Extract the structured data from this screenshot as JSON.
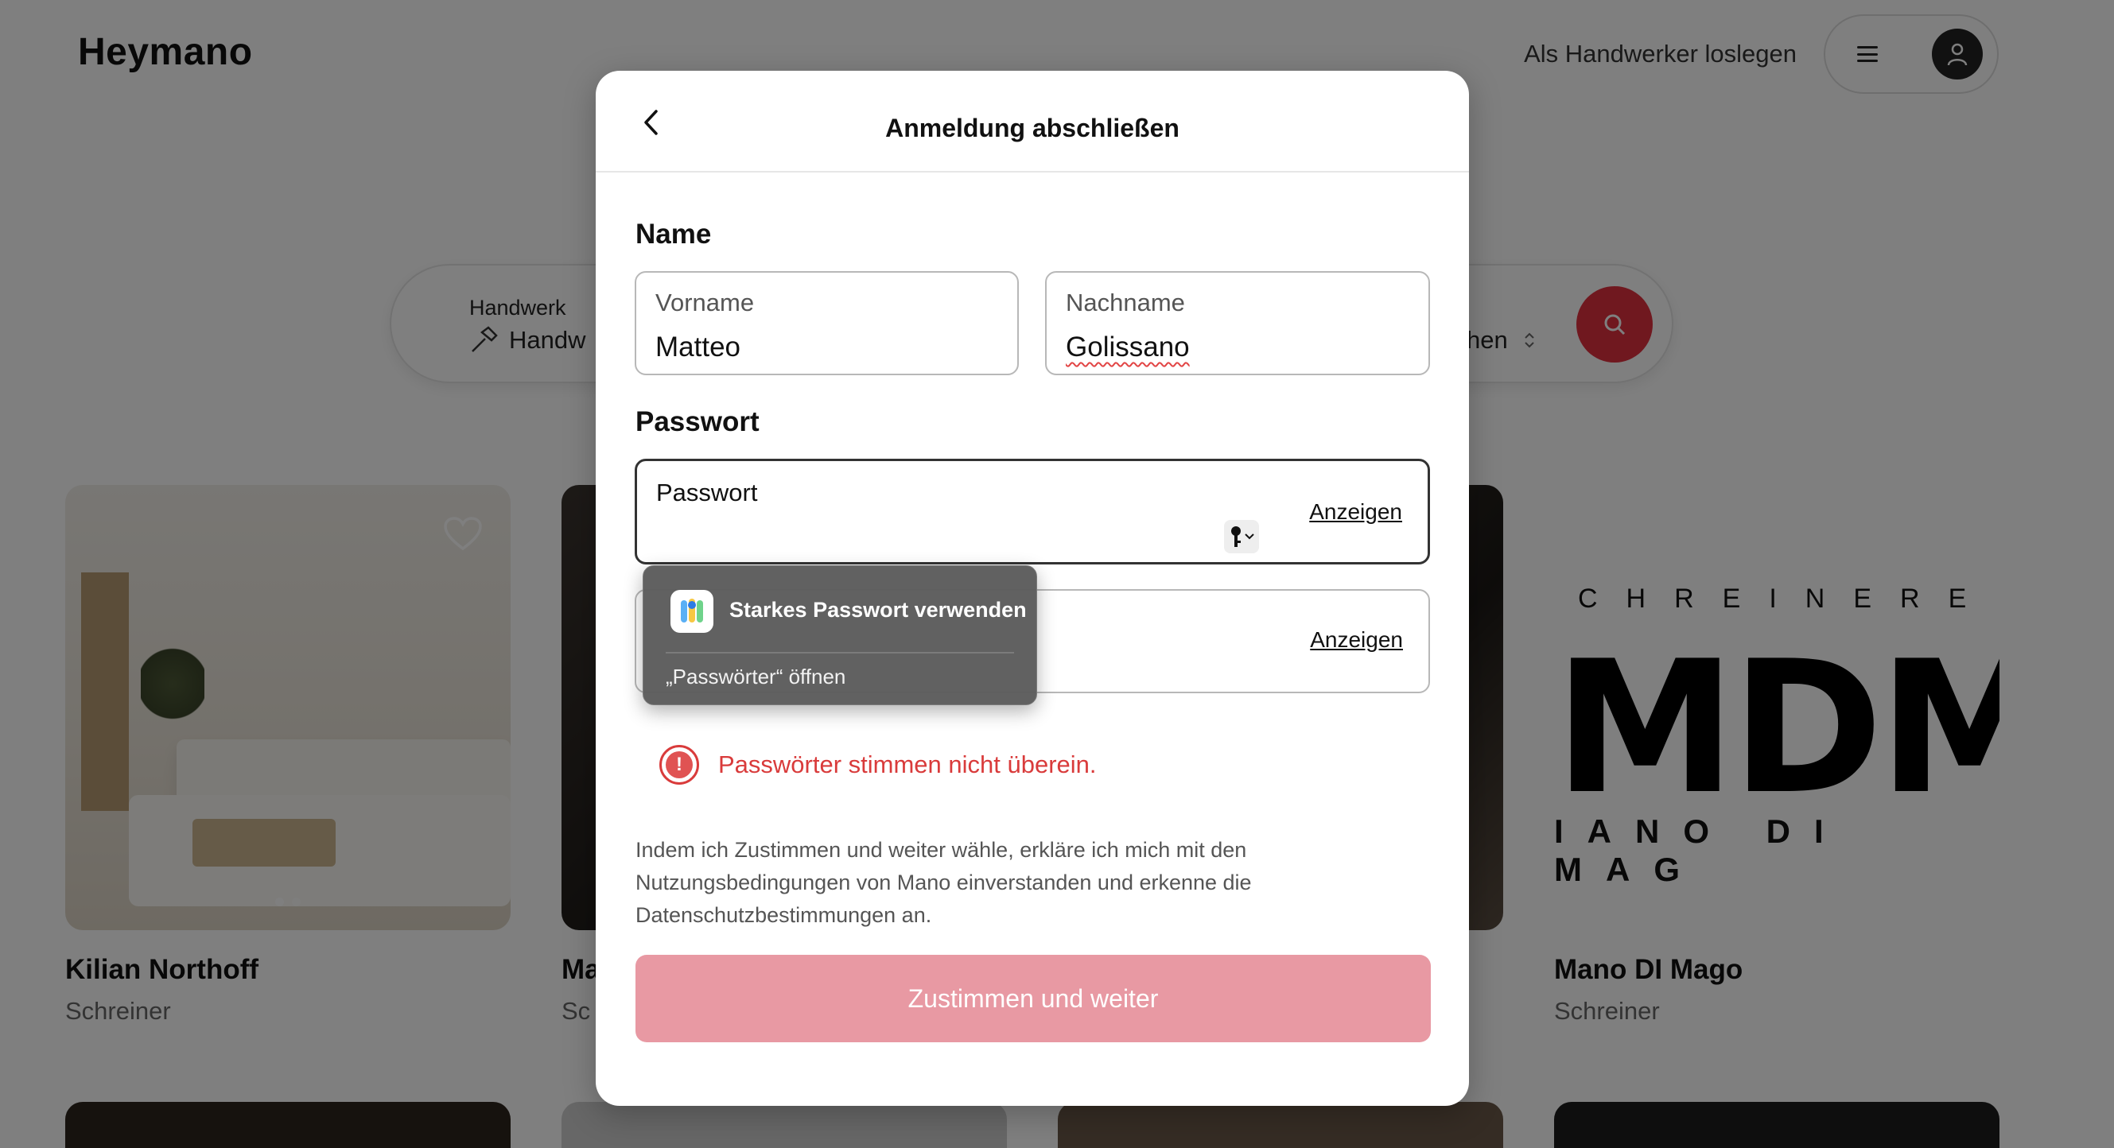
{
  "header": {
    "logo": "Heymano",
    "become_craftsman": "Als Handwerker loslegen"
  },
  "search": {
    "field1_label": "Handwerk",
    "field1_value": "Handw",
    "field2_value": "hen"
  },
  "cards": [
    {
      "name": "Kilian Northoff",
      "trade": "Schreiner"
    },
    {
      "name": "Ma",
      "trade": "Sc"
    },
    {
      "name": "Mano DI Mago",
      "trade": "Schreiner"
    }
  ],
  "mdm_logo": {
    "top": "CHREINERE",
    "main": "MDM",
    "bottom": "IANO DI MAG"
  },
  "modal": {
    "title": "Anmeldung abschließen",
    "name_section": "Name",
    "first_name_label": "Vorname",
    "first_name_value": "Matteo",
    "last_name_label": "Nachname",
    "last_name_value": "Golissano",
    "password_section": "Passwort",
    "password_placeholder": "Passwort",
    "show_label": "Anzeigen",
    "show_label_2": "Anzeigen",
    "error_icon": "!",
    "error_text": "Passwörter stimmen nicht überein.",
    "terms_text": "Indem ich Zustimmen und weiter wähle, erkläre ich mich mit den Nutzungsbedingungen von Mano einverstanden und erkenne die Datenschutzbestimmungen an.",
    "submit_label": "Zustimmen und weiter"
  },
  "password_popup": {
    "strong_password": "Starkes Passwort verwenden",
    "open_passwords": "„Passwörter“ öffnen"
  },
  "colors": {
    "accent": "#e0303f",
    "error": "#d93b3b",
    "submit_disabled": "#e899a3"
  }
}
